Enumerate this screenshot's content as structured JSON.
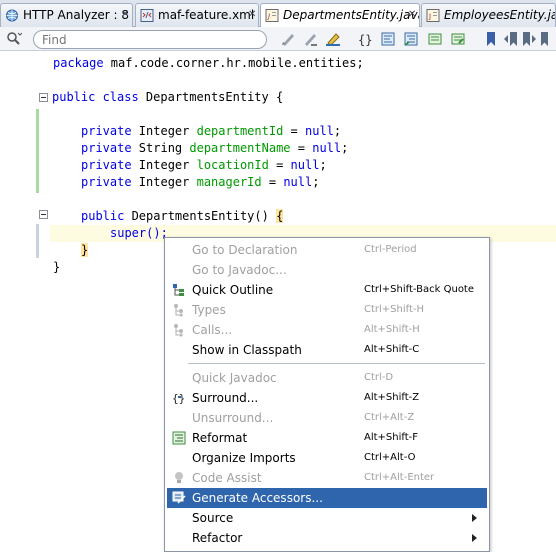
{
  "tabs": [
    {
      "label": "HTTP Analyzer : 8",
      "icon": "globe-icon",
      "active": false
    },
    {
      "label": "maf-feature.xml",
      "icon": "xml-file-icon",
      "active": false
    },
    {
      "label": "DepartmentsEntity.java",
      "icon": "java-file-icon",
      "active": true
    },
    {
      "label": "EmployeesEntity.java",
      "icon": "java-file-icon",
      "active": false
    }
  ],
  "close_glyph": "✕",
  "toolbar": {
    "search_placeholder": "Find",
    "icons": [
      "search-icon",
      "find-previous-icon",
      "find-next-icon",
      "toggle-highlight-icon",
      "brace-match-icon",
      "shift-left-icon",
      "shift-right-icon",
      "comment-icon",
      "uncomment-icon",
      "toggle-bookmark-icon",
      "previous-bookmark-icon",
      "next-bookmark-icon",
      "clear-bookmarks-icon"
    ]
  },
  "code": {
    "package_kw": "package",
    "package_name": " maf.code.corner.hr.mobile.entities;",
    "class_kw": "public class",
    "class_name": " DepartmentsEntity {",
    "fields": [
      {
        "kw": "private",
        "type": " Integer ",
        "name": "departmentId",
        "eq": " = ",
        "val": "null",
        "end": ";"
      },
      {
        "kw": "private",
        "type": " String ",
        "name": "departmentName",
        "eq": " = ",
        "val": "null",
        "end": ";"
      },
      {
        "kw": "private",
        "type": " Integer ",
        "name": "locationId",
        "eq": " = ",
        "val": "null",
        "end": ";"
      },
      {
        "kw": "private",
        "type": " Integer ",
        "name": "managerId",
        "eq": " = ",
        "val": "null",
        "end": ";"
      }
    ],
    "ctor_kw": "public",
    "ctor_name": " DepartmentsEntity() ",
    "open_brace": "{",
    "super_call": "super();",
    "close_brace": "}",
    "class_close": "}"
  },
  "context_menu": {
    "items": [
      {
        "label": "Go to Declaration",
        "shortcut": "Ctrl-Period",
        "enabled": false,
        "icon": ""
      },
      {
        "label": "Go to Javadoc...",
        "shortcut": "",
        "enabled": false,
        "icon": ""
      },
      {
        "label": "Quick Outline",
        "shortcut": "Ctrl+Shift-Back Quote",
        "enabled": true,
        "icon": "outline-icon"
      },
      {
        "label": "Types",
        "shortcut": "Ctrl+Shift-H",
        "enabled": false,
        "icon": "type-hierarchy-icon"
      },
      {
        "label": "Calls...",
        "shortcut": "Alt+Shift-H",
        "enabled": false,
        "icon": "call-hierarchy-icon"
      },
      {
        "label": "Show in Classpath",
        "shortcut": "Alt+Shift-C",
        "enabled": true,
        "icon": ""
      },
      {
        "label": "Quick Javadoc",
        "shortcut": "Ctrl-D",
        "enabled": false,
        "icon": ""
      },
      {
        "label": "Surround...",
        "shortcut": "Alt+Shift-Z",
        "enabled": true,
        "icon": "surround-icon"
      },
      {
        "label": "Unsurround...",
        "shortcut": "Ctrl+Alt-Z",
        "enabled": false,
        "icon": ""
      },
      {
        "label": "Reformat",
        "shortcut": "Alt+Shift-F",
        "enabled": true,
        "icon": "reformat-icon"
      },
      {
        "label": "Organize Imports",
        "shortcut": "Ctrl+Alt-O",
        "enabled": true,
        "icon": ""
      },
      {
        "label": "Code Assist",
        "shortcut": "Ctrl+Alt-Enter",
        "enabled": false,
        "icon": "lightbulb-icon"
      },
      {
        "label": "Generate Accessors...",
        "shortcut": "",
        "enabled": true,
        "highlighted": true,
        "icon": "generate-accessors-icon"
      },
      {
        "label": "Source",
        "shortcut": "",
        "enabled": true,
        "submenu": true,
        "icon": ""
      },
      {
        "label": "Refactor",
        "shortcut": "",
        "enabled": true,
        "submenu": true,
        "icon": ""
      }
    ]
  },
  "colors": {
    "keyword": "#0000e6",
    "field": "#009900",
    "menu_highlight": "#2f65ac",
    "disabled_text": "#a0a0a0"
  }
}
